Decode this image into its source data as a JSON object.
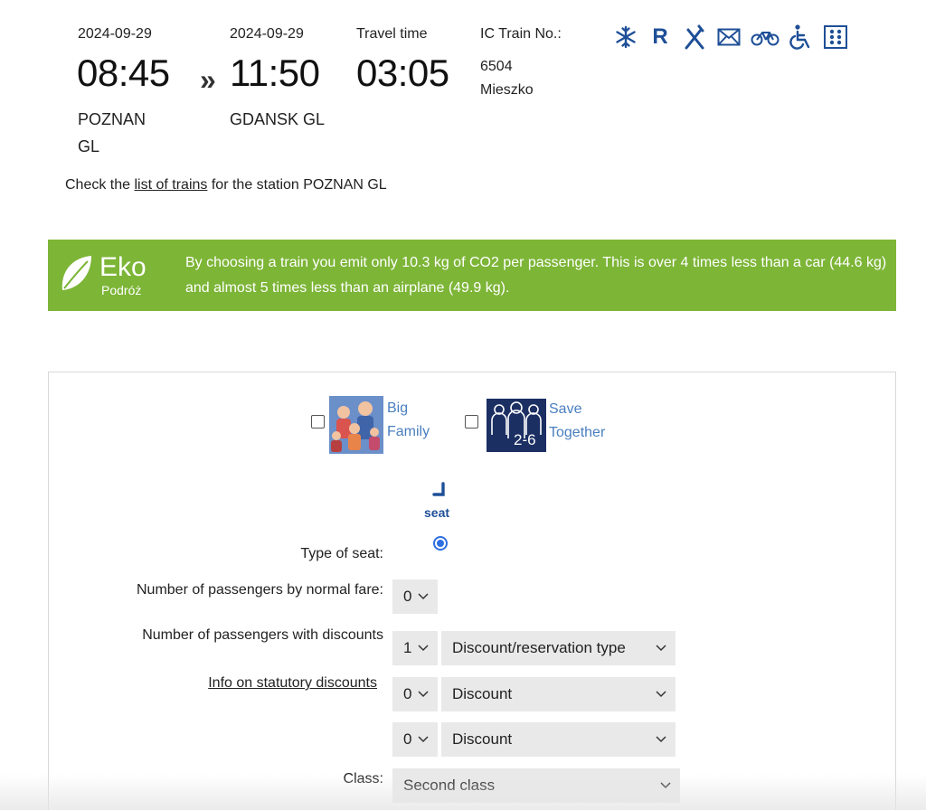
{
  "trip": {
    "departure": {
      "date": "2024-09-29",
      "time": "08:45",
      "station_line1": "POZNAN",
      "station_line2": "GL"
    },
    "separator": "»",
    "arrival": {
      "date": "2024-09-29",
      "time": "11:50",
      "station": "GDANSK GL"
    },
    "travel_time": {
      "label": "Travel time",
      "value": "03:05"
    },
    "train": {
      "label": "IC Train No.:",
      "number": "6504",
      "name": "Mieszko"
    }
  },
  "amenities": [
    "air-conditioning-icon",
    "reservation-icon",
    "restaurant-icon",
    "mail-icon",
    "bicycle-icon",
    "wheelchair-icon",
    "braille-icon"
  ],
  "amenity_reservation_letter": "R",
  "check_line": {
    "prefix": "Check the ",
    "link": "list of trains",
    "suffix": " for the station POZNAN GL"
  },
  "eco": {
    "logo_word": "Eko",
    "logo_sub": "Podróż",
    "text": "By choosing a train you emit only 10.3 kg of CO2 per passenger. This is over 4 times less than a car (44.6  kg) and almost 5 times less than an airplane (49.9 kg).",
    "color": "#7db537"
  },
  "offers": {
    "big_family": {
      "line1": "Big",
      "line2": "Family"
    },
    "save_together": {
      "line1": "Save",
      "line2": "Together",
      "badge": "2-6"
    }
  },
  "seat": {
    "label": "seat",
    "type_label": "Type of seat:"
  },
  "form": {
    "normal_fare": {
      "label": "Number of passengers by normal fare:",
      "value": "0"
    },
    "discounts": {
      "label": "Number of passengers with discounts",
      "count": "1",
      "type": "Discount/reservation type"
    },
    "statutory": {
      "link": "Info on statutory discounts",
      "count": "0",
      "type": "Discount"
    },
    "extra": {
      "count": "0",
      "type": "Discount"
    },
    "class": {
      "label": "Class:",
      "value": "Second class"
    }
  },
  "colors": {
    "accent_blue": "#1e4f97",
    "link_blue": "#4a7fc0",
    "radio_blue": "#2f6fe0",
    "select_bg": "#e9e9e9"
  }
}
